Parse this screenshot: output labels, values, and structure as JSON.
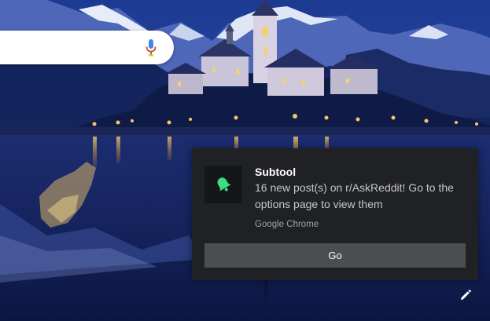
{
  "search": {
    "value": "",
    "placeholder": ""
  },
  "notification": {
    "app_name": "Subtool",
    "message": "16 new post(s) on r/AskReddit! Go to the options page to view them",
    "source": "Google Chrome",
    "action_label": "Go",
    "icon": "bell-icon",
    "icon_color": "#3ddc84"
  },
  "customize": {
    "icon": "pencil-icon"
  },
  "colors": {
    "toast_background": "#202124",
    "action_button": "#4b4d51",
    "mic_blue": "#4285f4",
    "mic_red": "#ea4335"
  }
}
